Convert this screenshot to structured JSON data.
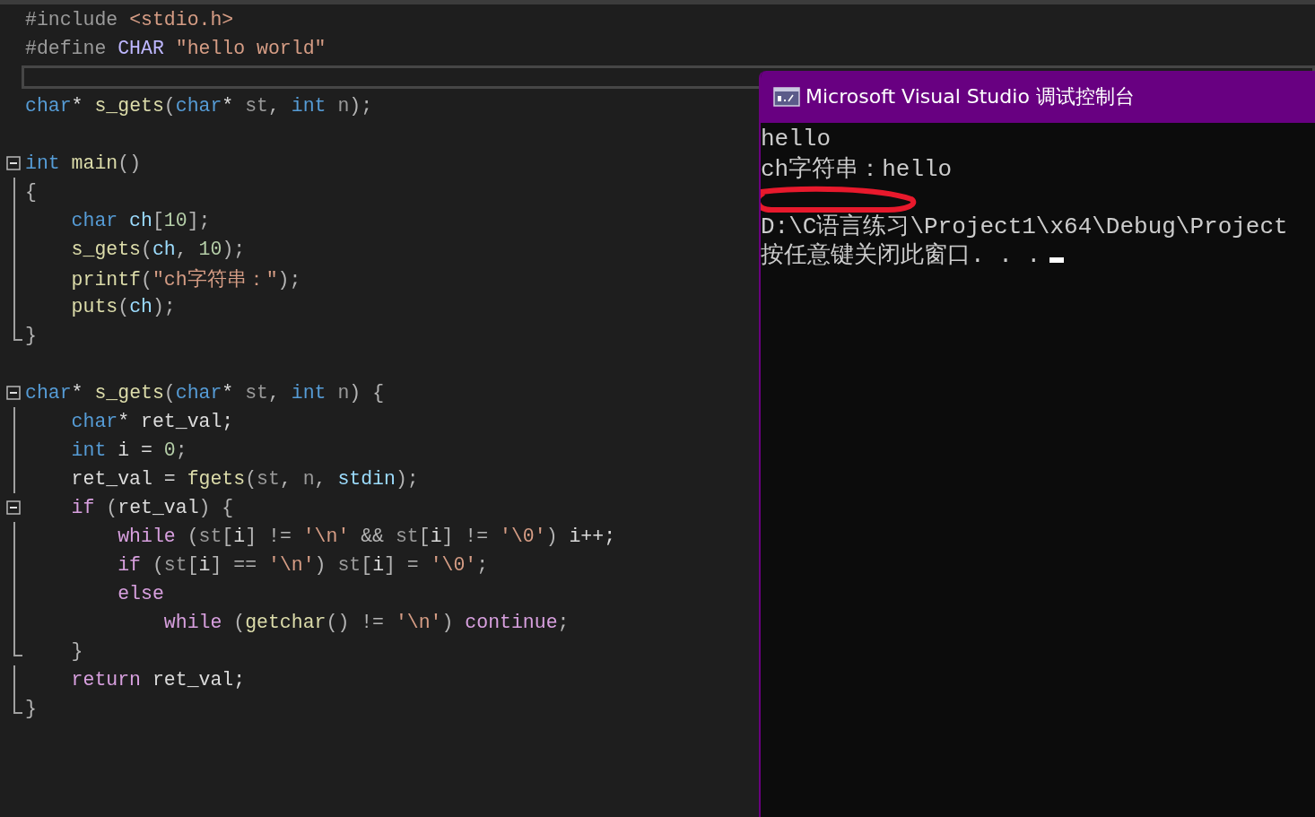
{
  "editor": {
    "lines": [
      {
        "kind": "code",
        "tokens": [
          {
            "kind": "pre",
            "s": "#include "
          },
          {
            "kind": "str",
            "s": "<stdio.h>"
          }
        ]
      },
      {
        "kind": "code",
        "tokens": [
          {
            "kind": "pre",
            "s": "#define "
          },
          {
            "kind": "macro",
            "s": "CHAR"
          },
          {
            "kind": "str",
            "s": " \"hello world\""
          }
        ]
      },
      {
        "kind": "current"
      },
      {
        "kind": "code",
        "tokens": [
          {
            "kind": "kw",
            "s": "char"
          },
          {
            "kind": "id",
            "s": "* "
          },
          {
            "kind": "fn",
            "s": "s_gets"
          },
          {
            "kind": "punct",
            "s": "("
          },
          {
            "kind": "kw",
            "s": "char"
          },
          {
            "kind": "id",
            "s": "* "
          },
          {
            "kind": "param",
            "s": "st"
          },
          {
            "kind": "punct",
            "s": ", "
          },
          {
            "kind": "kw",
            "s": "int"
          },
          {
            "kind": "param",
            "s": " n"
          },
          {
            "kind": "punct",
            "s": ");"
          }
        ]
      },
      {
        "kind": "blank"
      },
      {
        "kind": "code",
        "fold": {
          "kind": "toggle"
        },
        "tokens": [
          {
            "kind": "kw",
            "s": "int"
          },
          {
            "kind": "fn",
            "s": " main"
          },
          {
            "kind": "punct",
            "s": "()"
          }
        ]
      },
      {
        "kind": "code",
        "fold": {
          "kind": "bar"
        },
        "tokens": [
          {
            "kind": "punct",
            "s": "{"
          }
        ]
      },
      {
        "kind": "code",
        "fold": {
          "kind": "bar"
        },
        "tokens": [
          {
            "kind": "kw",
            "s": "    char"
          },
          {
            "kind": "var",
            "s": " ch"
          },
          {
            "kind": "punct",
            "s": "["
          },
          {
            "kind": "num",
            "s": "10"
          },
          {
            "kind": "punct",
            "s": "];"
          }
        ]
      },
      {
        "kind": "code",
        "fold": {
          "kind": "bar"
        },
        "tokens": [
          {
            "kind": "fn",
            "s": "    s_gets"
          },
          {
            "kind": "punct",
            "s": "("
          },
          {
            "kind": "var",
            "s": "ch"
          },
          {
            "kind": "punct",
            "s": ", "
          },
          {
            "kind": "num",
            "s": "10"
          },
          {
            "kind": "punct",
            "s": ");"
          }
        ]
      },
      {
        "kind": "code",
        "fold": {
          "kind": "bar"
        },
        "tokens": [
          {
            "kind": "fn",
            "s": "    printf"
          },
          {
            "kind": "punct",
            "s": "("
          },
          {
            "kind": "str",
            "s": "\"ch字符串：\""
          },
          {
            "kind": "punct",
            "s": ");"
          }
        ]
      },
      {
        "kind": "code",
        "fold": {
          "kind": "bar"
        },
        "tokens": [
          {
            "kind": "fn",
            "s": "    puts"
          },
          {
            "kind": "punct",
            "s": "("
          },
          {
            "kind": "var",
            "s": "ch"
          },
          {
            "kind": "punct",
            "s": ");"
          }
        ]
      },
      {
        "kind": "code",
        "fold": {
          "kind": "end"
        },
        "tokens": [
          {
            "kind": "punct",
            "s": "}"
          }
        ]
      },
      {
        "kind": "blank"
      },
      {
        "kind": "code",
        "fold": {
          "kind": "toggle"
        },
        "tokens": [
          {
            "kind": "kw",
            "s": "char"
          },
          {
            "kind": "id",
            "s": "* "
          },
          {
            "kind": "fn",
            "s": "s_gets"
          },
          {
            "kind": "punct",
            "s": "("
          },
          {
            "kind": "kw",
            "s": "char"
          },
          {
            "kind": "id",
            "s": "* "
          },
          {
            "kind": "param",
            "s": "st"
          },
          {
            "kind": "punct",
            "s": ", "
          },
          {
            "kind": "kw",
            "s": "int"
          },
          {
            "kind": "param",
            "s": " n"
          },
          {
            "kind": "punct",
            "s": ") {"
          }
        ]
      },
      {
        "kind": "code",
        "fold": {
          "kind": "bar"
        },
        "tokens": [
          {
            "kind": "kw",
            "s": "    char"
          },
          {
            "kind": "id",
            "s": "* ret_val;"
          }
        ]
      },
      {
        "kind": "code",
        "fold": {
          "kind": "bar"
        },
        "tokens": [
          {
            "kind": "kw",
            "s": "    int"
          },
          {
            "kind": "id",
            "s": " i = "
          },
          {
            "kind": "num",
            "s": "0"
          },
          {
            "kind": "punct",
            "s": ";"
          }
        ]
      },
      {
        "kind": "code",
        "fold": {
          "kind": "bar"
        },
        "tokens": [
          {
            "kind": "id",
            "s": "    ret_val = "
          },
          {
            "kind": "fn",
            "s": "fgets"
          },
          {
            "kind": "punct",
            "s": "("
          },
          {
            "kind": "param",
            "s": "st"
          },
          {
            "kind": "punct",
            "s": ", "
          },
          {
            "kind": "param",
            "s": "n"
          },
          {
            "kind": "punct",
            "s": ", "
          },
          {
            "kind": "var",
            "s": "stdin"
          },
          {
            "kind": "punct",
            "s": ");"
          }
        ]
      },
      {
        "kind": "code",
        "fold": {
          "kind": "toggle"
        },
        "tokens": [
          {
            "kind": "ctl",
            "s": "    if"
          },
          {
            "kind": "punct",
            "s": " ("
          },
          {
            "kind": "id",
            "s": "ret_val"
          },
          {
            "kind": "punct",
            "s": ") {"
          }
        ]
      },
      {
        "kind": "code",
        "fold": {
          "kind": "bar"
        },
        "tokens": [
          {
            "kind": "ctl",
            "s": "        while"
          },
          {
            "kind": "punct",
            "s": " ("
          },
          {
            "kind": "param",
            "s": "st"
          },
          {
            "kind": "punct",
            "s": "["
          },
          {
            "kind": "id",
            "s": "i"
          },
          {
            "kind": "punct",
            "s": "] != "
          },
          {
            "kind": "str",
            "s": "'\\n'"
          },
          {
            "kind": "punct",
            "s": " && "
          },
          {
            "kind": "param",
            "s": "st"
          },
          {
            "kind": "punct",
            "s": "["
          },
          {
            "kind": "id",
            "s": "i"
          },
          {
            "kind": "punct",
            "s": "] != "
          },
          {
            "kind": "str",
            "s": "'\\0'"
          },
          {
            "kind": "punct",
            "s": ") "
          },
          {
            "kind": "id",
            "s": "i++;"
          }
        ]
      },
      {
        "kind": "code",
        "fold": {
          "kind": "bar"
        },
        "tokens": [
          {
            "kind": "ctl",
            "s": "        if"
          },
          {
            "kind": "punct",
            "s": " ("
          },
          {
            "kind": "param",
            "s": "st"
          },
          {
            "kind": "punct",
            "s": "["
          },
          {
            "kind": "id",
            "s": "i"
          },
          {
            "kind": "punct",
            "s": "] == "
          },
          {
            "kind": "str",
            "s": "'\\n'"
          },
          {
            "kind": "punct",
            "s": ") "
          },
          {
            "kind": "param",
            "s": "st"
          },
          {
            "kind": "punct",
            "s": "["
          },
          {
            "kind": "id",
            "s": "i"
          },
          {
            "kind": "punct",
            "s": "] = "
          },
          {
            "kind": "str",
            "s": "'\\0'"
          },
          {
            "kind": "punct",
            "s": ";"
          }
        ]
      },
      {
        "kind": "code",
        "fold": {
          "kind": "bar"
        },
        "tokens": [
          {
            "kind": "ctl",
            "s": "        else"
          }
        ]
      },
      {
        "kind": "code",
        "fold": {
          "kind": "bar"
        },
        "tokens": [
          {
            "kind": "ctl",
            "s": "            while"
          },
          {
            "kind": "punct",
            "s": " ("
          },
          {
            "kind": "fn",
            "s": "getchar"
          },
          {
            "kind": "punct",
            "s": "() != "
          },
          {
            "kind": "str",
            "s": "'\\n'"
          },
          {
            "kind": "punct",
            "s": ") "
          },
          {
            "kind": "ctl",
            "s": "continue"
          },
          {
            "kind": "punct",
            "s": ";"
          }
        ]
      },
      {
        "kind": "code",
        "fold": {
          "kind": "end"
        },
        "tokens": [
          {
            "kind": "punct",
            "s": "    }"
          }
        ]
      },
      {
        "kind": "code",
        "fold": {
          "kind": "bar"
        },
        "tokens": [
          {
            "kind": "ctl",
            "s": "    return"
          },
          {
            "kind": "id",
            "s": " ret_val;"
          }
        ]
      },
      {
        "kind": "code",
        "fold": {
          "kind": "end"
        },
        "tokens": [
          {
            "kind": "punct",
            "s": "}"
          }
        ]
      }
    ]
  },
  "console": {
    "title": "Microsoft Visual Studio 调试控制台",
    "lines": [
      {
        "kind": "text",
        "text": "hello"
      },
      {
        "kind": "text",
        "text": "ch字符串：hello"
      },
      {
        "kind": "marked-blank"
      },
      {
        "kind": "text",
        "text": "D:\\C语言练习\\Project1\\x64\\Debug\\Project"
      },
      {
        "kind": "prompt",
        "text": "按任意键关闭此窗口. . ."
      }
    ]
  }
}
